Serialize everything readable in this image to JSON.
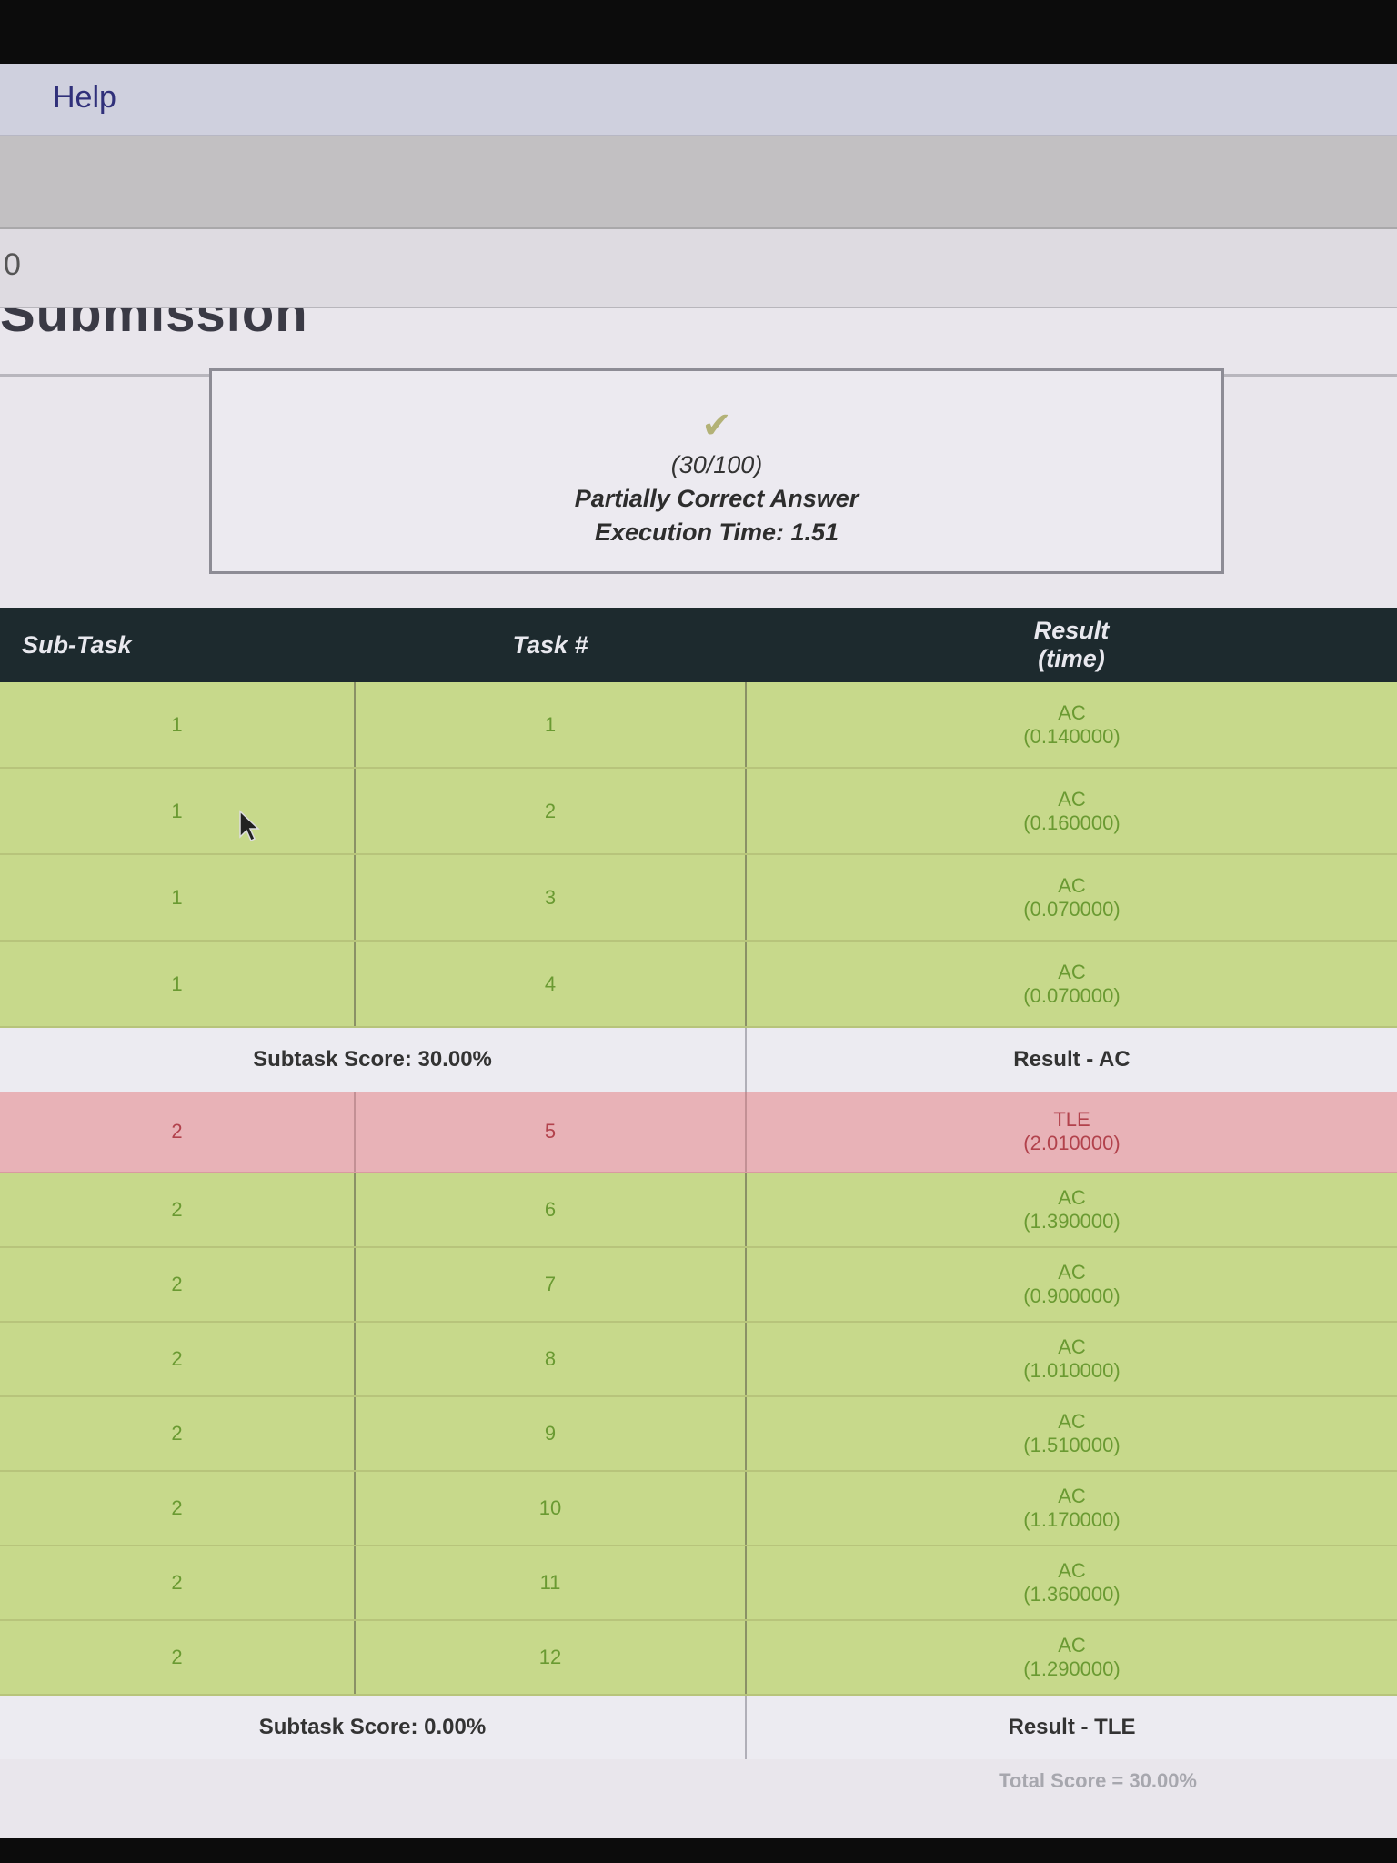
{
  "menubar": {
    "items": [
      "Help"
    ]
  },
  "urlbar": {
    "text": "0"
  },
  "page_heading": "Submission",
  "verdict": {
    "score": "(30/100)",
    "status": "Partially Correct Answer",
    "execution_time": "Execution Time: 1.51"
  },
  "table": {
    "headers": {
      "subtask": "Sub-Task",
      "task": "Task #",
      "result": "Result",
      "result_sub": "(time)"
    },
    "groups": [
      {
        "rows": [
          {
            "subtask": "1",
            "task": "1",
            "result": "AC",
            "time": "(0.140000)",
            "status": "ac"
          },
          {
            "subtask": "1",
            "task": "2",
            "result": "AC",
            "time": "(0.160000)",
            "status": "ac"
          },
          {
            "subtask": "1",
            "task": "3",
            "result": "AC",
            "time": "(0.070000)",
            "status": "ac"
          },
          {
            "subtask": "1",
            "task": "4",
            "result": "AC",
            "time": "(0.070000)",
            "status": "ac"
          }
        ],
        "subtask_score": "Subtask Score: 30.00%",
        "result": "Result - AC"
      },
      {
        "rows": [
          {
            "subtask": "2",
            "task": "5",
            "result": "TLE",
            "time": "(2.010000)",
            "status": "tle"
          },
          {
            "subtask": "2",
            "task": "6",
            "result": "AC",
            "time": "(1.390000)",
            "status": "ac"
          },
          {
            "subtask": "2",
            "task": "7",
            "result": "AC",
            "time": "(0.900000)",
            "status": "ac"
          },
          {
            "subtask": "2",
            "task": "8",
            "result": "AC",
            "time": "(1.010000)",
            "status": "ac"
          },
          {
            "subtask": "2",
            "task": "9",
            "result": "AC",
            "time": "(1.510000)",
            "status": "ac"
          },
          {
            "subtask": "2",
            "task": "10",
            "result": "AC",
            "time": "(1.170000)",
            "status": "ac"
          },
          {
            "subtask": "2",
            "task": "11",
            "result": "AC",
            "time": "(1.360000)",
            "status": "ac"
          },
          {
            "subtask": "2",
            "task": "12",
            "result": "AC",
            "time": "(1.290000)",
            "status": "ac"
          }
        ],
        "subtask_score": "Subtask Score: 0.00%",
        "result": "Result - TLE"
      }
    ]
  },
  "total_score": "Total Score = 30.00%",
  "colors": {
    "ac_bg": "#c7d98b",
    "ac_text": "#6a9a32",
    "tle_bg": "#e8b2b7",
    "tle_text": "#b2424c",
    "header_bg": "#1d2a2e"
  }
}
